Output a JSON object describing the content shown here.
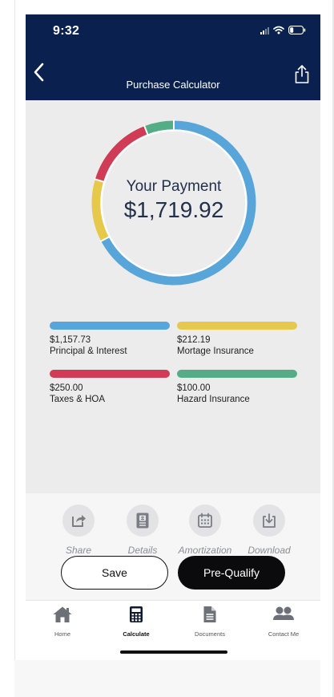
{
  "status": {
    "time": "9:32"
  },
  "header": {
    "title": "Purchase Calculator"
  },
  "summary": {
    "label": "Your Payment",
    "value": "$1,719.92",
    "total": 1719.92
  },
  "colors": {
    "header": "#0a2150",
    "principal": "#57a5d9",
    "mortgage_insurance": "#e6c84a",
    "taxes": "#d03c55",
    "hazard": "#53ad86"
  },
  "breakdown": [
    {
      "value": "$1,157.73",
      "label": "Principal & Interest",
      "amount": 1157.73,
      "color": "#57a5d9"
    },
    {
      "value": "$212.19",
      "label": "Mortage Insurance",
      "amount": 212.19,
      "color": "#e6c84a"
    },
    {
      "value": "$250.00",
      "label": "Taxes & HOA",
      "amount": 250.0,
      "color": "#d03c55"
    },
    {
      "value": "$100.00",
      "label": "Hazard Insurance",
      "amount": 100.0,
      "color": "#53ad86"
    }
  ],
  "actions": [
    {
      "label": "Share",
      "icon": "share-arrow-icon"
    },
    {
      "label": "Details",
      "icon": "details-document-icon"
    },
    {
      "label": "Amortization",
      "icon": "calendar-icon"
    },
    {
      "label": "Download",
      "icon": "download-icon"
    }
  ],
  "buttons": {
    "save": "Save",
    "prequalify": "Pre-Qualify"
  },
  "tabs": [
    {
      "label": "Home",
      "icon": "home-icon",
      "active": false
    },
    {
      "label": "Calculate",
      "icon": "calculator-icon",
      "active": true
    },
    {
      "label": "Documents",
      "icon": "document-icon",
      "active": false
    },
    {
      "label": "Contact Me",
      "icon": "contacts-icon",
      "active": false
    }
  ]
}
